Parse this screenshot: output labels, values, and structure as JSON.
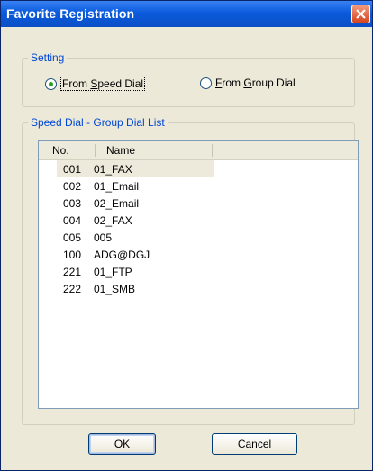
{
  "window": {
    "title": "Favorite Registration"
  },
  "setting": {
    "legend": "Setting",
    "speed_dial": {
      "prefix": "From ",
      "accel": "S",
      "rest": "peed Dial",
      "selected": true
    },
    "group_dial": {
      "accel": "F",
      "rest": "rom ",
      "accel2": "G",
      "rest2": "roup Dial",
      "selected": false
    }
  },
  "list": {
    "legend": "Speed Dial - Group Dial List",
    "columns": {
      "no": "No.",
      "name": "Name"
    },
    "rows": [
      {
        "no": "001",
        "name": "01_FAX"
      },
      {
        "no": "002",
        "name": "01_Email"
      },
      {
        "no": "003",
        "name": "02_Email"
      },
      {
        "no": "004",
        "name": "02_FAX"
      },
      {
        "no": "005",
        "name": "005"
      },
      {
        "no": "100",
        "name": "ADG@DGJ"
      },
      {
        "no": "221",
        "name": "01_FTP"
      },
      {
        "no": "222",
        "name": "01_SMB"
      }
    ]
  },
  "buttons": {
    "ok": "OK",
    "cancel": "Cancel"
  },
  "icons": {
    "close": "close-icon",
    "radio_selected": "radio-selected-icon",
    "radio_unselected": "radio-unselected-icon"
  },
  "colors": {
    "title_bar": "#0a5bdc",
    "legend_text": "#0046d5",
    "dialog_bg": "#ece9d8",
    "selected_row": "#eeeadb"
  }
}
